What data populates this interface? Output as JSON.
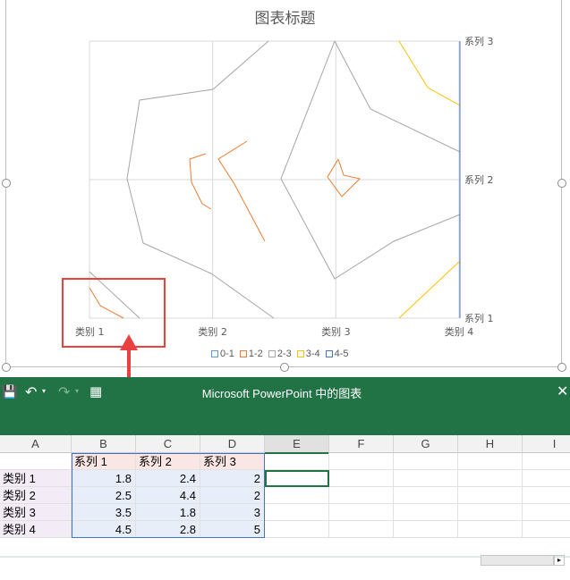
{
  "chart": {
    "title": "图表标题",
    "legend": [
      "0-1",
      "1-2",
      "2-3",
      "3-4",
      "4-5"
    ],
    "colors": {
      "0-1": "#5b9bd5",
      "1-2": "#ed7d31",
      "2-3": "#a5a5a5",
      "3-4": "#ffc000",
      "4-5": "#4472c4"
    }
  },
  "chart_data": {
    "type": "surface-contour",
    "title": "图表标题",
    "categories": [
      "类别 1",
      "类别 2",
      "类别 3",
      "类别 4"
    ],
    "series": [
      {
        "name": "系列 1",
        "values": [
          1.8,
          2.5,
          3.5,
          4.5
        ]
      },
      {
        "name": "系列 2",
        "values": [
          2.4,
          4.4,
          1.8,
          2.8
        ]
      },
      {
        "name": "系列 3",
        "values": [
          2,
          2,
          3,
          5
        ]
      }
    ],
    "legend": [
      "0-1",
      "1-2",
      "2-3",
      "3-4",
      "4-5"
    ],
    "legend_position": "bottom"
  },
  "app": {
    "title": "Microsoft PowerPoint 中的图表"
  },
  "sheet": {
    "columns": [
      "A",
      "B",
      "C",
      "D",
      "E",
      "F",
      "G",
      "H",
      "I"
    ],
    "header_row": [
      "",
      "系列 1",
      "系列 2",
      "系列 3"
    ],
    "rows": [
      [
        "类别 1",
        "1.8",
        "2.4",
        "2"
      ],
      [
        "类别 2",
        "2.5",
        "4.4",
        "2"
      ],
      [
        "类别 3",
        "3.5",
        "1.8",
        "3"
      ],
      [
        "类别 4",
        "4.5",
        "2.8",
        "5"
      ]
    ]
  }
}
